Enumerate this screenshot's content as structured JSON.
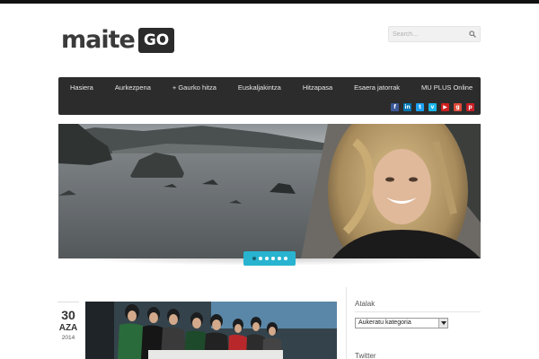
{
  "header": {
    "logo_word": "maite",
    "logo_badge": "GO",
    "search_placeholder": "Search..."
  },
  "nav": {
    "items": [
      "Hasiera",
      "Aurkezpena",
      "+ Gaurko hitza",
      "Euskaljakintza",
      "Hitzapasa",
      "Esaera jatorrak",
      "MU PLUS Online"
    ]
  },
  "socials": [
    {
      "name": "facebook-icon",
      "glyph": "f",
      "color": "#3b5998"
    },
    {
      "name": "linkedin-icon",
      "glyph": "in",
      "color": "#0077b5"
    },
    {
      "name": "twitter-icon",
      "glyph": "t",
      "color": "#1da1f2"
    },
    {
      "name": "vimeo-icon",
      "glyph": "v",
      "color": "#1ab7ea"
    },
    {
      "name": "youtube-icon",
      "glyph": "▶",
      "color": "#cd201f"
    },
    {
      "name": "google-plus-icon",
      "glyph": "g",
      "color": "#dd4b39"
    },
    {
      "name": "pinterest-icon",
      "glyph": "p",
      "color": "#cb2027"
    }
  ],
  "slider": {
    "slide_count": 6,
    "active_index": 0
  },
  "post": {
    "day": "30",
    "month": "AZA",
    "year": "2014"
  },
  "sidebar": {
    "categories_title": "Atalak",
    "categories_selected": "Aukeratu kategoria",
    "twitter_title": "Twitter"
  },
  "colors": {
    "nav_bg": "#2c2c2c",
    "accent": "#28b4d0"
  }
}
